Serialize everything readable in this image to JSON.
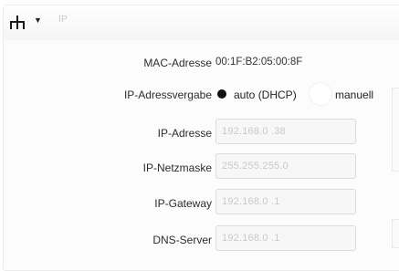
{
  "header": {
    "section_title": "IP",
    "icon": "network-icon",
    "toggle_icon": "caret-down-icon"
  },
  "mac": {
    "label": "MAC-Adresse",
    "value": "00:1F:B2:05:00:8F"
  },
  "assignment": {
    "label": "IP-Adressvergabe",
    "option_auto": "auto (DHCP)",
    "option_manual": "manuell",
    "selected": "auto (DHCP)"
  },
  "fields": {
    "ip": {
      "label": "IP-Adresse",
      "value": "192.168.0 .38"
    },
    "netmask": {
      "label": "IP-Netzmaske",
      "value": "255.255.255.0"
    },
    "gateway": {
      "label": "IP-Gateway",
      "value": "192.168.0 .1"
    },
    "dns": {
      "label": "DNS-Server",
      "value": "192.168.0 .1"
    }
  }
}
